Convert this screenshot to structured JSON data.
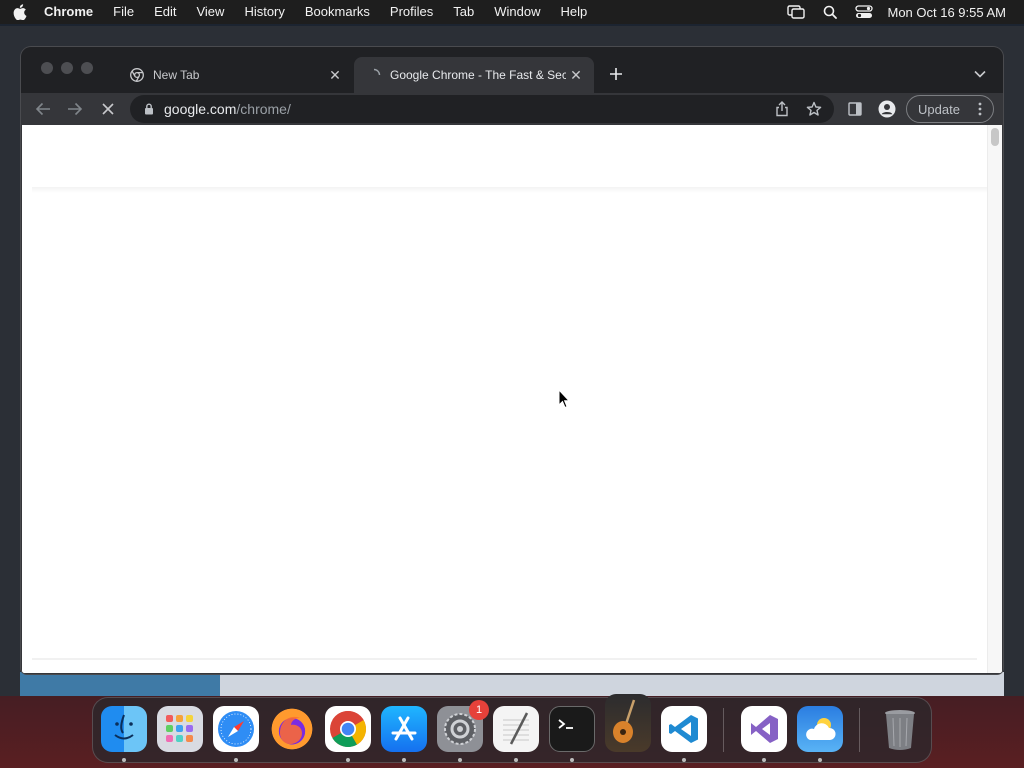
{
  "menubar": {
    "app_name": "Chrome",
    "items": [
      "File",
      "Edit",
      "View",
      "History",
      "Bookmarks",
      "Profiles",
      "Tab",
      "Window",
      "Help"
    ],
    "clock": "Mon Oct 16  9:55 AM"
  },
  "browser": {
    "tabs": [
      {
        "title": "New Tab",
        "state": "inactive",
        "icon": "chrome-icon"
      },
      {
        "title": "Google Chrome - The Fast & Secure Web Browser",
        "state": "active-loading",
        "icon": "loading-spinner-icon"
      }
    ],
    "address": {
      "domain": "google.com",
      "path": "/chrome/"
    },
    "update_label": "Update"
  },
  "dock": {
    "apps": [
      {
        "name": "Finder",
        "icon": "finder-icon"
      },
      {
        "name": "Launchpad",
        "icon": "launchpad-icon"
      },
      {
        "name": "Safari",
        "icon": "safari-icon"
      },
      {
        "name": "Firefox",
        "icon": "firefox-icon"
      },
      {
        "name": "Google Chrome",
        "icon": "chrome-icon"
      },
      {
        "name": "App Store",
        "icon": "app-store-icon"
      },
      {
        "name": "System Settings",
        "icon": "settings-gear-icon",
        "badge": "1"
      },
      {
        "name": "TextEdit",
        "icon": "textedit-icon"
      },
      {
        "name": "Terminal",
        "icon": "terminal-icon"
      },
      {
        "name": "GarageBand",
        "icon": "guitar-icon"
      },
      {
        "name": "Visual Studio Code",
        "icon": "vscode-icon"
      },
      {
        "name": "Visual Studio",
        "icon": "visual-studio-icon"
      },
      {
        "name": "Weather",
        "icon": "weather-icon"
      },
      {
        "name": "Trash",
        "icon": "trash-icon"
      }
    ]
  },
  "colors": {
    "menubar_bg": "#1e1e1e",
    "tabstrip_bg": "#202124",
    "toolbar_bg": "#35363a",
    "content_bg": "#ffffff",
    "badge": "#e5413a"
  }
}
